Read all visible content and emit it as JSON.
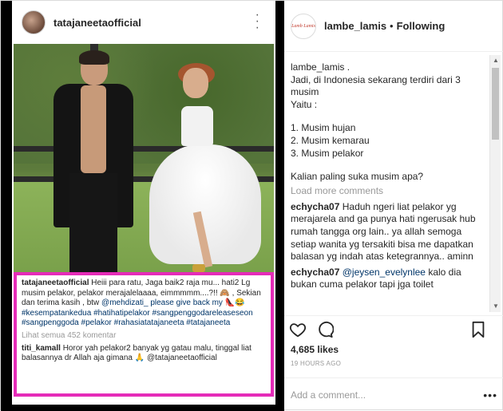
{
  "embedded_post": {
    "username": "tatajaneetaofficial",
    "more_icon": "more-vertical-icon",
    "caption": {
      "user": "tatajaneetaofficial",
      "text_1": "Heiii para ratu, Jaga baik2 raja mu... hati2 Lg musim pelakor, pelakor merajalelaaaa, eimmmmm....?!! 🙈 , Sekian dan terima kasih , btw",
      "text_2": "@mehdizati_  please give back my 👠😂",
      "hashtags": "#kesempatankedua #hatihatipelakor #sangpenggodareleaseseon #sangpenggoda #pelakor #rahasiatatajaneeta #tatajaneeta",
      "view_all": "Lihat semua 452 komentar",
      "comment_user": "titi_kamall",
      "comment_text": "Horor yah pelakor2 banyak yg gatau malu, tinggal liat balasannya dr Allah aja gimana 🙏",
      "comment_mention": "@tatajaneetaofficial"
    }
  },
  "sidebar": {
    "username": "lambe_lamis",
    "avatar_text": "Lamb Lamis",
    "separator": "•",
    "follow_status": "Following",
    "caption_user": "lambe_lamis",
    "caption_lines": [
      "lambe_lamis .",
      "Jadi, di Indonesia sekarang terdiri dari 3 musim",
      "Yaitu :",
      "",
      "1. Musim hujan",
      "2. Musim kemarau",
      "3. Musim pelakor",
      "",
      "Kalian paling suka musim apa?"
    ],
    "load_more": "Load more comments",
    "comments": [
      {
        "user": "echycha07",
        "mention": "",
        "text": "Haduh ngeri liat pelakor yg merajarela and ga punya hati ngerusak hub rumah tangga org lain.. ya allah semoga setiap wanita yg tersakiti bisa me dapatkan balasan yg indah atas ketegrannya.. aminn"
      },
      {
        "user": "echycha07",
        "mention": "@jeysen_evelynlee",
        "text": " kalo dia bukan cuma pelakor tapi jga toilet"
      }
    ],
    "likes": "4,685 likes",
    "timestamp": "19 HOURS AGO",
    "add_comment_placeholder": "Add a comment...",
    "options_label": "•••",
    "icons": [
      "heart-icon",
      "comment-icon",
      "bookmark-icon"
    ]
  }
}
